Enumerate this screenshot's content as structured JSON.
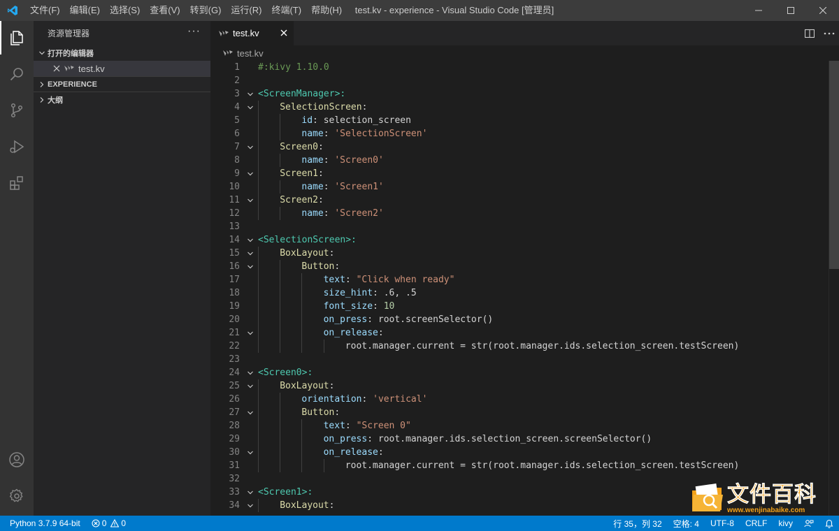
{
  "titlebar": {
    "menu": [
      "文件(F)",
      "编辑(E)",
      "选择(S)",
      "查看(V)",
      "转到(G)",
      "运行(R)",
      "终端(T)",
      "帮助(H)"
    ],
    "title": "test.kv - experience - Visual Studio Code [管理员]"
  },
  "sidebar": {
    "header": "资源管理器",
    "more": "···",
    "open_editors_label": "打开的编辑器",
    "open_file": "test.kv",
    "experience_label": "EXPERIENCE",
    "outline_label": "大纲"
  },
  "editor": {
    "tab_label": "test.kv",
    "breadcrumb": "test.kv"
  },
  "code_lines": [
    {
      "n": "1",
      "indent": 0,
      "fold": false,
      "parts": [
        [
          "c-comment",
          "#:kivy 1.10.0"
        ]
      ]
    },
    {
      "n": "2",
      "indent": 0,
      "fold": false,
      "parts": []
    },
    {
      "n": "3",
      "indent": 0,
      "fold": true,
      "parts": [
        [
          "c-tag",
          "<ScreenManager>:"
        ]
      ]
    },
    {
      "n": "4",
      "indent": 1,
      "fold": true,
      "parts": [
        [
          "c-widget",
          "SelectionScreen"
        ],
        [
          "",
          ":"
        ]
      ]
    },
    {
      "n": "5",
      "indent": 2,
      "fold": false,
      "parts": [
        [
          "c-prop",
          "id"
        ],
        [
          "",
          ": selection_screen"
        ]
      ]
    },
    {
      "n": "6",
      "indent": 2,
      "fold": false,
      "parts": [
        [
          "c-prop",
          "name"
        ],
        [
          "",
          ": "
        ],
        [
          "c-str",
          "'SelectionScreen'"
        ]
      ]
    },
    {
      "n": "7",
      "indent": 1,
      "fold": true,
      "parts": [
        [
          "c-widget",
          "Screen0"
        ],
        [
          "",
          ":"
        ]
      ]
    },
    {
      "n": "8",
      "indent": 2,
      "fold": false,
      "parts": [
        [
          "c-prop",
          "name"
        ],
        [
          "",
          ": "
        ],
        [
          "c-str",
          "'Screen0'"
        ]
      ]
    },
    {
      "n": "9",
      "indent": 1,
      "fold": true,
      "parts": [
        [
          "c-widget",
          "Screen1"
        ],
        [
          "",
          ":"
        ]
      ]
    },
    {
      "n": "10",
      "indent": 2,
      "fold": false,
      "parts": [
        [
          "c-prop",
          "name"
        ],
        [
          "",
          ": "
        ],
        [
          "c-str",
          "'Screen1'"
        ]
      ]
    },
    {
      "n": "11",
      "indent": 1,
      "fold": true,
      "parts": [
        [
          "c-widget",
          "Screen2"
        ],
        [
          "",
          ":"
        ]
      ]
    },
    {
      "n": "12",
      "indent": 2,
      "fold": false,
      "parts": [
        [
          "c-prop",
          "name"
        ],
        [
          "",
          ": "
        ],
        [
          "c-str",
          "'Screen2'"
        ]
      ]
    },
    {
      "n": "13",
      "indent": 0,
      "fold": false,
      "parts": []
    },
    {
      "n": "14",
      "indent": 0,
      "fold": true,
      "parts": [
        [
          "c-tag",
          "<SelectionScreen>:"
        ]
      ]
    },
    {
      "n": "15",
      "indent": 1,
      "fold": true,
      "parts": [
        [
          "c-widget",
          "BoxLayout"
        ],
        [
          "",
          ":"
        ]
      ]
    },
    {
      "n": "16",
      "indent": 2,
      "fold": true,
      "parts": [
        [
          "c-widget",
          "Button"
        ],
        [
          "",
          ":"
        ]
      ]
    },
    {
      "n": "17",
      "indent": 3,
      "fold": false,
      "parts": [
        [
          "c-prop",
          "text"
        ],
        [
          "",
          ": "
        ],
        [
          "c-str",
          "\"Click when ready\""
        ]
      ]
    },
    {
      "n": "18",
      "indent": 3,
      "fold": false,
      "parts": [
        [
          "c-prop",
          "size_hint"
        ],
        [
          "",
          ": .6, .5"
        ]
      ]
    },
    {
      "n": "19",
      "indent": 3,
      "fold": false,
      "parts": [
        [
          "c-prop",
          "font_size"
        ],
        [
          "",
          ": "
        ],
        [
          "c-num",
          "10"
        ]
      ]
    },
    {
      "n": "20",
      "indent": 3,
      "fold": false,
      "parts": [
        [
          "c-prop",
          "on_press"
        ],
        [
          "",
          ": root.screenSelector()"
        ]
      ]
    },
    {
      "n": "21",
      "indent": 3,
      "fold": true,
      "parts": [
        [
          "c-prop",
          "on_release"
        ],
        [
          "",
          ":"
        ]
      ]
    },
    {
      "n": "22",
      "indent": 4,
      "fold": false,
      "parts": [
        [
          "",
          "root.manager.current = str(root.manager.ids.selection_screen.testScreen)"
        ]
      ]
    },
    {
      "n": "23",
      "indent": 0,
      "fold": false,
      "parts": []
    },
    {
      "n": "24",
      "indent": 0,
      "fold": true,
      "parts": [
        [
          "c-tag",
          "<Screen0>:"
        ]
      ]
    },
    {
      "n": "25",
      "indent": 1,
      "fold": true,
      "parts": [
        [
          "c-widget",
          "BoxLayout"
        ],
        [
          "",
          ":"
        ]
      ]
    },
    {
      "n": "26",
      "indent": 2,
      "fold": false,
      "parts": [
        [
          "c-prop",
          "orientation"
        ],
        [
          "",
          ": "
        ],
        [
          "c-str",
          "'vertical'"
        ]
      ]
    },
    {
      "n": "27",
      "indent": 2,
      "fold": true,
      "parts": [
        [
          "c-widget",
          "Button"
        ],
        [
          "",
          ":"
        ]
      ]
    },
    {
      "n": "28",
      "indent": 3,
      "fold": false,
      "parts": [
        [
          "c-prop",
          "text"
        ],
        [
          "",
          ": "
        ],
        [
          "c-str",
          "\"Screen 0\""
        ]
      ]
    },
    {
      "n": "29",
      "indent": 3,
      "fold": false,
      "parts": [
        [
          "c-prop",
          "on_press"
        ],
        [
          "",
          ": root.manager.ids.selection_screen.screenSelector()"
        ]
      ]
    },
    {
      "n": "30",
      "indent": 3,
      "fold": true,
      "parts": [
        [
          "c-prop",
          "on_release"
        ],
        [
          "",
          ":"
        ]
      ]
    },
    {
      "n": "31",
      "indent": 4,
      "fold": false,
      "parts": [
        [
          "",
          "root.manager.current = str(root.manager.ids.selection_screen.testScreen)"
        ]
      ]
    },
    {
      "n": "32",
      "indent": 0,
      "fold": false,
      "parts": []
    },
    {
      "n": "33",
      "indent": 0,
      "fold": true,
      "parts": [
        [
          "c-tag",
          "<Screen1>:"
        ]
      ]
    },
    {
      "n": "34",
      "indent": 1,
      "fold": true,
      "parts": [
        [
          "c-widget",
          "BoxLayout"
        ],
        [
          "",
          ":"
        ]
      ]
    }
  ],
  "statusbar": {
    "python": "Python 3.7.9 64-bit",
    "errors": "0",
    "warnings": "0",
    "position": "行 35，列 32",
    "spaces": "空格: 4",
    "encoding": "UTF-8",
    "eol": "CRLF",
    "language": "kivy"
  },
  "watermark": {
    "title": "文件百科",
    "url": "www.wenjinabaike.com"
  },
  "colors": {
    "accent": "#007acc",
    "vscode_blue": "#23a9f2",
    "watermark": "#f3a21a"
  }
}
